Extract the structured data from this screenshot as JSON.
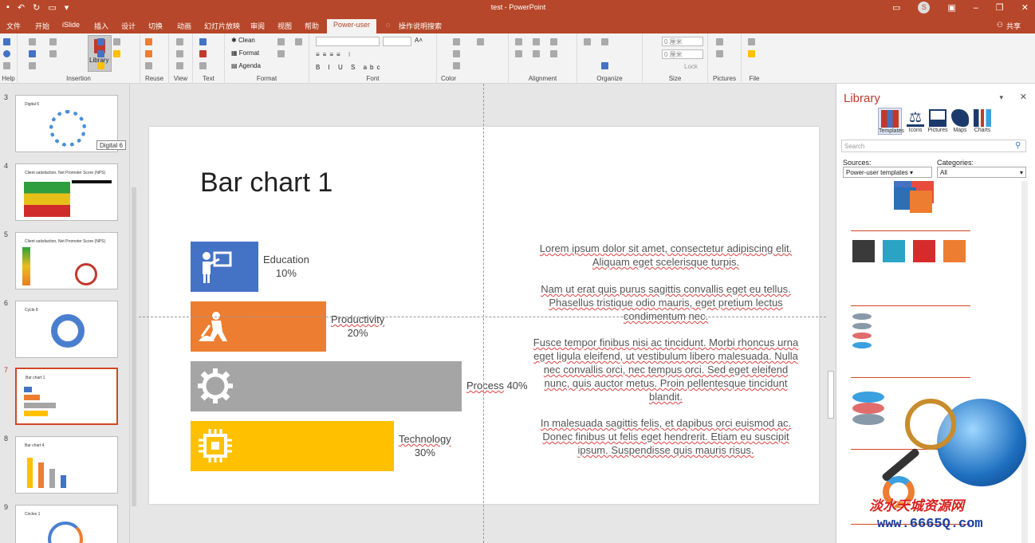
{
  "window": {
    "title": "test  -  PowerPoint",
    "qat_icons": [
      "save-icon",
      "undo-icon",
      "redo-icon",
      "present-icon",
      "more-icon"
    ],
    "avatar_letter": "S"
  },
  "tabs": [
    "文件",
    "开始",
    "iSlide",
    "插入",
    "设计",
    "切换",
    "动画",
    "幻灯片放映",
    "审阅",
    "视图",
    "帮助",
    "Power-user"
  ],
  "tell_me": "操作说明搜索",
  "share": "共享",
  "ribbon": {
    "groups": [
      "Help",
      "Insertion",
      "Reuse",
      "View",
      "Text",
      "Format",
      "Font",
      "Color",
      "Alignment",
      "Organize",
      "Size",
      "Pictures",
      "File"
    ],
    "library_label": "Library",
    "format_items": [
      "Clean",
      "Format",
      "Agenda"
    ],
    "size_fields": [
      "0 厘米",
      "0 厘米"
    ],
    "lock_label": "Lock"
  },
  "thumbnails": [
    {
      "num": "3",
      "title": "Digital 6"
    },
    {
      "num": "4",
      "title": "Client satisfaction, Net Promoter Score (NPS)"
    },
    {
      "num": "5",
      "title": "Client satisfaction, Net Promoter Score (NPS)"
    },
    {
      "num": "6",
      "title": "Cycle 8"
    },
    {
      "num": "7",
      "title": "Bar chart 1"
    },
    {
      "num": "8",
      "title": "Bar chart 4"
    },
    {
      "num": "9",
      "title": "Circles 1"
    }
  ],
  "tooltip": "Digital 6",
  "slide": {
    "title": "Bar chart 1",
    "lorem": [
      "Lorem ipsum dolor sit amet, consectetur adipiscing elit. Aliquam eget scelerisque turpis.",
      "Nam ut erat quis purus sagittis convallis eget eu tellus. Phasellus tristique odio mauris, eget pretium lectus condimentum nec.",
      "Fusce tempor finibus nisi ac tincidunt. Morbi rhoncus urna eget ligula eleifend, ut vestibulum libero malesuada. Nulla nec convallis orci, nec tempus orci. Sed eget eleifend nunc, quis auctor metus. Proin pellentesque tincidunt blandit.",
      "In malesuada sagittis felis, et dapibus orci euismod ac. Donec finibus ut felis eget hendrerit. Etiam eu suscipit ipsum. Suspendisse quis mauris risus."
    ]
  },
  "chart_data": {
    "type": "bar",
    "categories": [
      "Education",
      "Productivity",
      "Process",
      "Technology"
    ],
    "values": [
      10,
      20,
      40,
      30
    ],
    "value_labels": [
      "10%",
      "20%",
      "40%",
      "30%"
    ],
    "colors": [
      "#4472c4",
      "#ed7d31",
      "#a5a5a5",
      "#ffc000"
    ],
    "icons": [
      "teacher-icon",
      "worker-icon",
      "gear-icon",
      "chip-icon"
    ],
    "title": "Bar chart 1",
    "xlabel": "",
    "ylabel": "",
    "xlim": [
      0,
      40
    ]
  },
  "library": {
    "title": "Library",
    "tabs": [
      "Templates",
      "Icons",
      "Pictures",
      "Maps",
      "Charts"
    ],
    "search_placeholder": "Search",
    "sources_label": "Sources:",
    "sources_value": "Power-user templates",
    "categories_label": "Categories:",
    "categories_value": "All"
  },
  "watermark": {
    "cn": "淡水天城资源网",
    "url": "www.6665Q.com"
  }
}
